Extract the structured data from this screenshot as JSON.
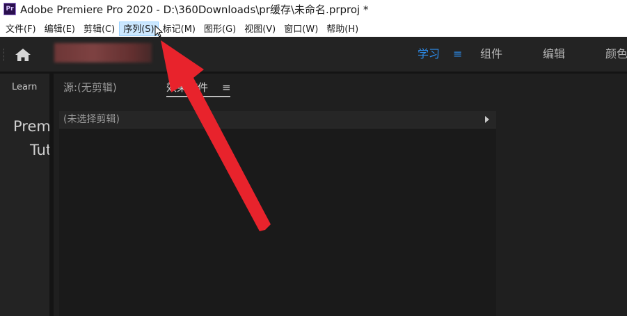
{
  "window": {
    "app_icon_label": "Pr",
    "title": "Adobe Premiere Pro 2020 - D:\\360Downloads\\pr缓存\\未命名.prproj *"
  },
  "menubar": {
    "items": [
      {
        "label": "文件(F)"
      },
      {
        "label": "编辑(E)"
      },
      {
        "label": "剪辑(C)"
      },
      {
        "label": "序列(S)",
        "hovered": true
      },
      {
        "label": "标记(M)"
      },
      {
        "label": "图形(G)"
      },
      {
        "label": "视图(V)"
      },
      {
        "label": "窗口(W)"
      },
      {
        "label": "帮助(H)"
      }
    ]
  },
  "workspace": {
    "home_icon": "home-icon",
    "tabs": [
      {
        "label": "学习",
        "active": true
      },
      {
        "label": "组件"
      },
      {
        "label": "编辑"
      },
      {
        "label": "颜色"
      }
    ],
    "menu_icon": "≡",
    "active_color": "#2d8ceb"
  },
  "learn_panel": {
    "tab_label": "Learn",
    "line1": "Premiere Pro",
    "line2": "Tutorials"
  },
  "main_panel": {
    "tabs": [
      {
        "label": "源:(无剪辑)"
      },
      {
        "label": "效果控件",
        "active": true
      }
    ],
    "menu_icon": "≡",
    "clip_header": "(未选择剪辑)",
    "expand_icon": "play-right-icon"
  },
  "annotation": {
    "arrow_color": "#e8232c"
  }
}
